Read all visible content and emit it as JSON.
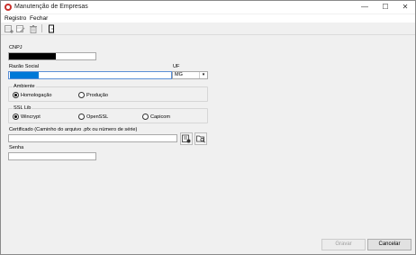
{
  "window": {
    "title": "Manutenção de Empresas"
  },
  "menu": {
    "items": [
      "Registro",
      "Fechar"
    ]
  },
  "toolbar": {
    "icons": [
      "new-record-icon",
      "edit-record-icon",
      "delete-record-icon",
      "exit-door-icon"
    ]
  },
  "form": {
    "cnpj": {
      "label": "CNPJ",
      "value": ""
    },
    "razao_social": {
      "label": "Razão Social",
      "value": ""
    },
    "uf": {
      "label": "UF",
      "value": "MG"
    },
    "ambiente": {
      "title": "Ambiente",
      "options": [
        "Homologação",
        "Produção"
      ],
      "selected": "Homologação"
    },
    "ssl_lib": {
      "title": "SSL Lib",
      "options": [
        "Wincrypt",
        "OpenSSL",
        "Capicom"
      ],
      "selected": "Wincrypt"
    },
    "certificado": {
      "label": "Certificado (Caminho do arquivo .pfx ou número de série)",
      "value": ""
    },
    "senha": {
      "label": "Senha",
      "value": ""
    }
  },
  "buttons": {
    "gravar": "Gravar",
    "cancelar": "Cancelar"
  }
}
